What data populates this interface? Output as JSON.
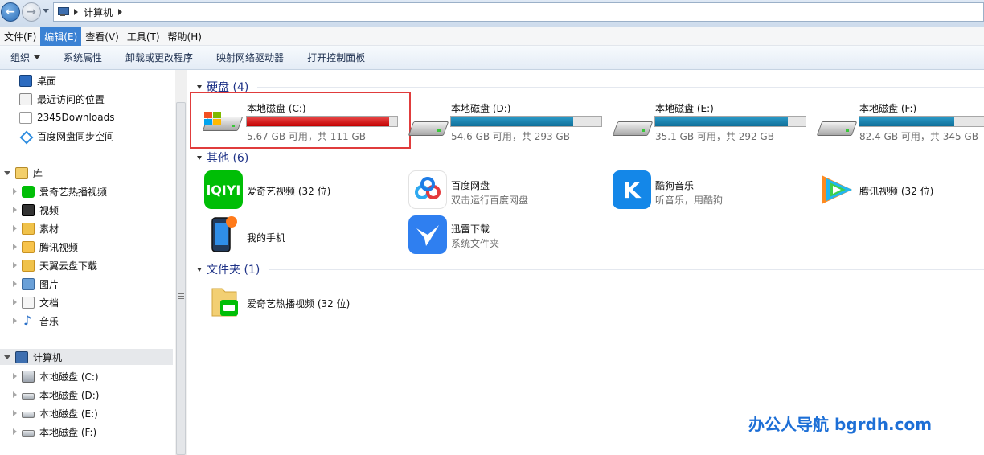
{
  "address_bar": {
    "path": [
      "计算机"
    ]
  },
  "menu": [
    "文件(F)",
    "编辑(E)",
    "查看(V)",
    "工具(T)",
    "帮助(H)"
  ],
  "toolbar": [
    "组织",
    "系统属性",
    "卸载或更改程序",
    "映射网络驱动器",
    "打开控制面板"
  ],
  "sidebar": {
    "favorites": [
      {
        "label": "桌面",
        "icon": "desktop-icon"
      },
      {
        "label": "最近访问的位置",
        "icon": "recent-places-icon"
      },
      {
        "label": "2345Downloads",
        "icon": "folder-icon"
      },
      {
        "label": "百度网盘同步空间",
        "icon": "baidu-sync-icon"
      }
    ],
    "libraries_label": "库",
    "libraries": [
      {
        "label": "爱奇艺热播视频",
        "icon": "iqiyi-icon"
      },
      {
        "label": "视频",
        "icon": "video-icon"
      },
      {
        "label": "素材",
        "icon": "folder-icon"
      },
      {
        "label": "腾讯视频",
        "icon": "tencent-video-icon"
      },
      {
        "label": "天翼云盘下载",
        "icon": "tianyi-cloud-icon"
      },
      {
        "label": "图片",
        "icon": "pictures-icon"
      },
      {
        "label": "文档",
        "icon": "documents-icon"
      },
      {
        "label": "音乐",
        "icon": "music-icon"
      }
    ],
    "computer_label": "计算机",
    "drives": [
      {
        "label": "本地磁盘 (C:)"
      },
      {
        "label": "本地磁盘 (D:)"
      },
      {
        "label": "本地磁盘 (E:)"
      },
      {
        "label": "本地磁盘 (F:)"
      }
    ]
  },
  "content": {
    "groups": {
      "hard_disks": "硬盘 (4)",
      "other": "其他 (6)",
      "folders": "文件夹 (1)"
    },
    "drives": [
      {
        "name": "本地磁盘 (C:)",
        "space": "5.67 GB 可用，共 111 GB",
        "used_fraction": 0.949,
        "color": "#c30000"
      },
      {
        "name": "本地磁盘 (D:)",
        "space": "54.6 GB 可用，共 293 GB",
        "used_fraction": 0.814,
        "color": "#0f6f99"
      },
      {
        "name": "本地磁盘 (E:)",
        "space": "35.1 GB 可用，共 292 GB",
        "used_fraction": 0.88,
        "color": "#0f6f99"
      },
      {
        "name": "本地磁盘 (F:)",
        "space": "82.4 GB 可用，共 345 GB",
        "used_fraction": 0.761,
        "color": "#0f6f99"
      }
    ],
    "other": [
      {
        "name": "爱奇艺视频 (32 位)",
        "sub": "",
        "icon": "iqiyi-app-icon",
        "glyph": "iQIYI"
      },
      {
        "name": "百度网盘",
        "sub": "双击运行百度网盘",
        "icon": "baidu-netdisk-icon",
        "glyph": ""
      },
      {
        "name": "酷狗音乐",
        "sub": "听音乐，用酷狗",
        "icon": "kugou-icon",
        "glyph": "K"
      },
      {
        "name": "腾讯视频 (32 位)",
        "sub": "",
        "icon": "tencent-video-app-icon",
        "glyph": ""
      },
      {
        "name": "我的手机",
        "sub": "",
        "icon": "phone-icon",
        "glyph": ""
      },
      {
        "name": "迅雷下载",
        "sub": "系统文件夹",
        "icon": "xunlei-icon",
        "glyph": ""
      }
    ],
    "folders": [
      {
        "name": "爱奇艺热播视频 (32 位)",
        "icon": "iqiyi-folder-icon"
      }
    ]
  },
  "watermark": "办公人导航 bgrdh.com"
}
